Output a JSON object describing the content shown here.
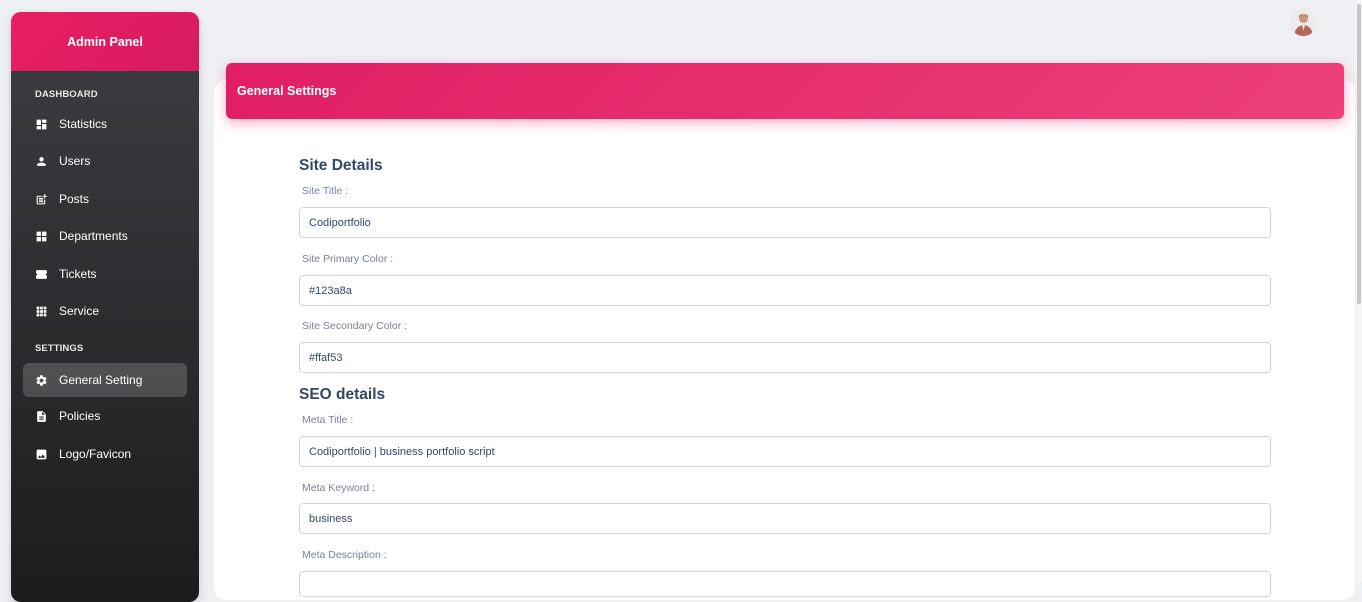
{
  "sidebar": {
    "brand": "Admin Panel",
    "sections": [
      {
        "title": "DASHBOARD"
      },
      {
        "title": "SETTINGS"
      }
    ],
    "items": [
      {
        "label": "Statistics",
        "icon": "dashboard-icon"
      },
      {
        "label": "Users",
        "icon": "person-icon"
      },
      {
        "label": "Posts",
        "icon": "post-add-icon"
      },
      {
        "label": "Departments",
        "icon": "grid-icon"
      },
      {
        "label": "Tickets",
        "icon": "ticket-icon"
      },
      {
        "label": "Service",
        "icon": "apps-icon"
      },
      {
        "label": "General Setting",
        "icon": "gear-icon",
        "active": true
      },
      {
        "label": "Policies",
        "icon": "document-icon"
      },
      {
        "label": "Logo/Favicon",
        "icon": "image-icon"
      }
    ]
  },
  "header": {
    "avatar": "user-avatar"
  },
  "card": {
    "title": "General Settings",
    "site_details": {
      "heading": "Site Details",
      "fields": [
        {
          "label": "Site Title :",
          "value": "Codiportfolio"
        },
        {
          "label": "Site Primary Color :",
          "value": "#123a8a"
        },
        {
          "label": "Site Secondary Color :",
          "value": "#ffaf53"
        }
      ]
    },
    "seo_details": {
      "heading": "SEO details",
      "fields": [
        {
          "label": "Meta Title :",
          "value": "Codiportfolio | business portfolio script"
        },
        {
          "label": "Meta Keyword :",
          "value": "business"
        },
        {
          "label": "Meta Description :",
          "value": ""
        }
      ]
    }
  },
  "colors": {
    "accent": "#e91e63",
    "sidebar_dark": "#2a2a2d",
    "text": "#344767",
    "label": "#7b809a"
  }
}
